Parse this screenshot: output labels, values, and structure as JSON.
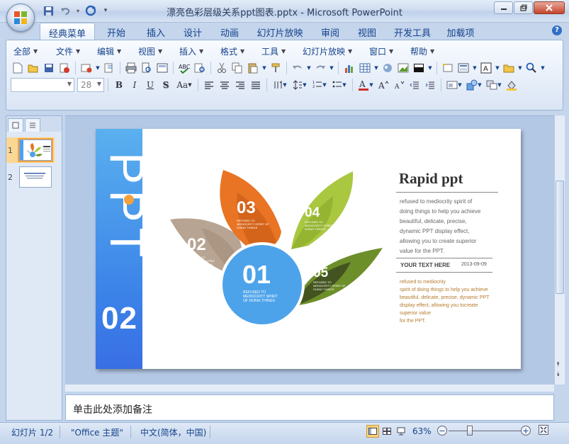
{
  "window": {
    "title": "漂亮色彩层级关系ppt图表.pptx - Microsoft PowerPoint"
  },
  "tabs": [
    {
      "label": "经典菜单",
      "active": true
    },
    {
      "label": "开始"
    },
    {
      "label": "插入"
    },
    {
      "label": "设计"
    },
    {
      "label": "动画"
    },
    {
      "label": "幻灯片放映"
    },
    {
      "label": "审阅"
    },
    {
      "label": "视图"
    },
    {
      "label": "开发工具"
    },
    {
      "label": "加载项"
    }
  ],
  "menu": [
    {
      "label": "全部"
    },
    {
      "label": "文件"
    },
    {
      "label": "编辑"
    },
    {
      "label": "视图"
    },
    {
      "label": "插入"
    },
    {
      "label": "格式"
    },
    {
      "label": "工具"
    },
    {
      "label": "幻灯片放映"
    },
    {
      "label": "窗口"
    },
    {
      "label": "帮助"
    }
  ],
  "font": {
    "name_value": "",
    "size_value": "28"
  },
  "slides_pane": {
    "items": [
      {
        "number": "1",
        "selected": true
      },
      {
        "number": "2",
        "selected": false
      }
    ]
  },
  "slide": {
    "band_text": "PPT",
    "band_number": "02",
    "petals": [
      {
        "num": "01",
        "text": "REFUSED TO\nMEDIOCRITY SPIRIT\nOF DOING THINGS",
        "color": "#4da3ea"
      },
      {
        "num": "02",
        "text": "REFUSED TO\nMEDIOCRITY SPIRIT\nOF DOING THINGS",
        "color": "#b8a492"
      },
      {
        "num": "03",
        "text": "REFUSED TO\nMEDIOCRITY SPIRIT OF\nDOING THINGS",
        "color": "#e87424"
      },
      {
        "num": "04",
        "text": "REFUSED TO\nMEDIOCRITY SPIRIT OF\nDOING THINGS",
        "color": "#a9c73f"
      },
      {
        "num": "05",
        "text": "REFUSED TO\nMEDIOCRITY SPIRIT OF\nDOING THINGS",
        "color": "#6d8f2a"
      }
    ],
    "right_title": "Rapid ppt",
    "right_paragraph": [
      "refused to mediocrity spirit of",
      "doing things to help you achieve",
      "beautiful,  delicate,  precise,",
      "dynamic PPT display effect,",
      "allowing you to create superior",
      "value for the PPT."
    ],
    "section_header": "YOUR TEXT  HERE",
    "section_date": "2013-09-09",
    "section_paragraph": [
      "refused to mediocrity",
      "spirit of doing things to help you achieve",
      "beautiful, delicate, precise, dynamic PPT",
      "display effect, allowing you tocreate",
      "superior value",
      "for the PPT."
    ]
  },
  "notes": {
    "placeholder": "单击此处添加备注"
  },
  "status": {
    "slide_info": "幻灯片 1/2",
    "theme": "\"Office 主题\"",
    "language": "中文(简体，中国)",
    "zoom": "63%"
  },
  "colors": {
    "accent": "#15428b",
    "band_top": "#5ab0ef",
    "band_bottom": "#3a6fe4"
  }
}
